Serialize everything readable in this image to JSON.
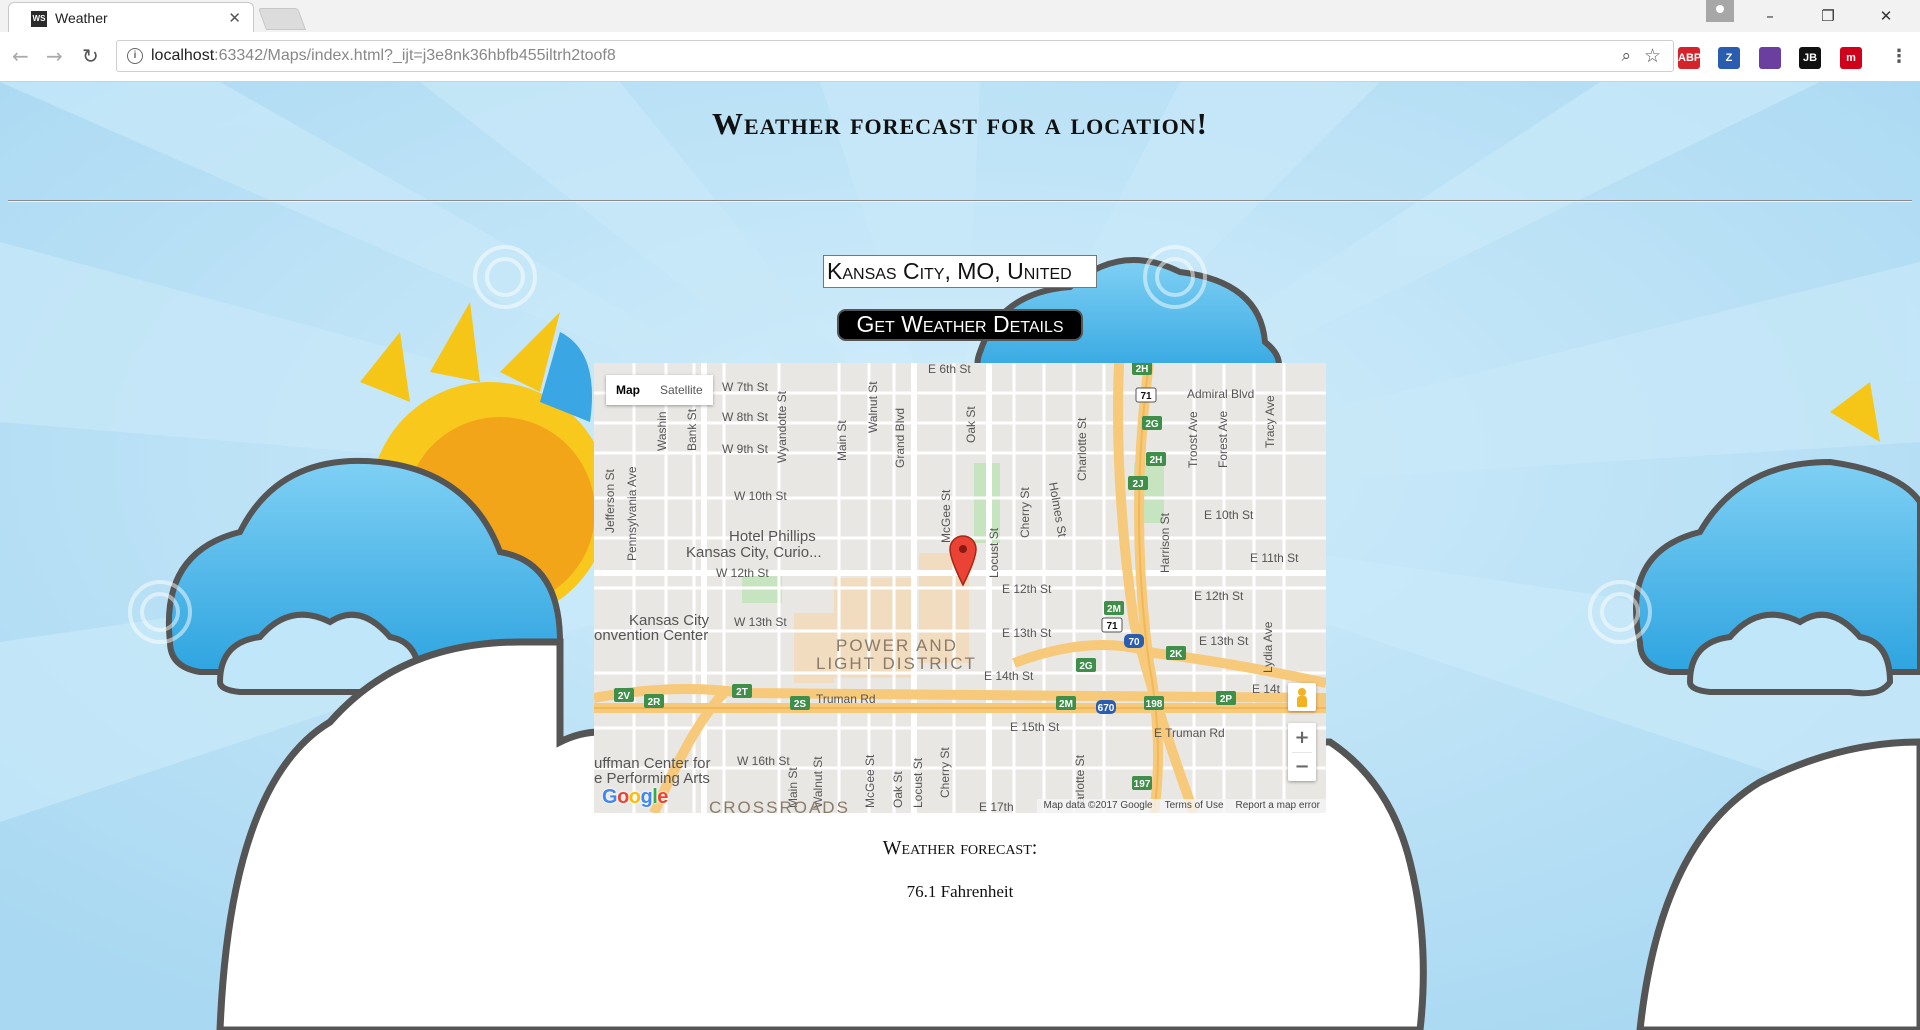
{
  "browser": {
    "tab_title": "Weather",
    "tab_icon": "webstorm-icon",
    "tab_icon_text": "WS",
    "url_host": "localhost",
    "url_rest": ":63342/Maps/index.html?_ijt=j3e8nk36hbfb455iltrh2toof8",
    "extensions": [
      {
        "name": "adblock-plus-icon",
        "label": "ABP",
        "color": "#d4232a"
      },
      {
        "name": "zotero-icon",
        "label": "Z",
        "color": "#2a5db0"
      },
      {
        "name": "bookmark-extension-icon",
        "label": "",
        "color": "#6a3fa0"
      },
      {
        "name": "jetbrains-icon",
        "label": "JB",
        "color": "#111111"
      },
      {
        "name": "m-extension-icon",
        "label": "m",
        "color": "#d0021b"
      }
    ]
  },
  "page": {
    "title": "Weather forecast for a location!",
    "city_value": "Kansas City, MO, United",
    "get_button": "Get Weather Details",
    "forecast_label": "Weather forecast:",
    "forecast_value": "76.1 Fahrenheit"
  },
  "map": {
    "type_map": "Map",
    "type_satellite": "Satellite",
    "zoom_in": "+",
    "zoom_out": "−",
    "map_data": "Map data ©2017 Google",
    "terms": "Terms of Use",
    "report": "Report a map error",
    "logo_letters": [
      "G",
      "o",
      "o",
      "g",
      "l",
      "e"
    ],
    "logo_colors": [
      "#4285f4",
      "#ea4335",
      "#fbbc05",
      "#4285f4",
      "#34a853",
      "#ea4335"
    ],
    "labels": {
      "e6th": "E 6th St",
      "w7th": "W 7th St",
      "w8th": "W 8th St",
      "w9th": "W 9th St",
      "w10th": "W 10th St",
      "w12th": "W 12th St",
      "w13th": "W 13th St",
      "w16th": "W 16th St",
      "e10th": "E 10th St",
      "e11th": "E 11th St",
      "e12th": "E 12th St",
      "e12th_b": "E 12th St",
      "e13th": "E 13th St",
      "e13th_b": "E 13th St",
      "e14th": "E 14th St",
      "e14t": "E 14t",
      "e15th": "E 15th St",
      "e17th": "E 17th",
      "truman": "Truman Rd",
      "e_truman": "E Truman Rd",
      "admiral": "Admiral Blvd",
      "jefferson": "Jefferson St",
      "pennsylvania": "Pennsylvania Ave",
      "washin": "Washin",
      "bank": "Bank St",
      "wyandotte": "Wyandotte St",
      "main": "Main St",
      "walnut": "Walnut St",
      "grand": "Grand Blvd",
      "oak": "Oak St",
      "mcgee": "McGee St",
      "locust": "Locust St",
      "cherry": "Cherry St",
      "holmes": "Holmes St",
      "charlotte": "Charlotte St",
      "harrison": "Harrison St",
      "troost": "Troost Ave",
      "forest": "Forest Ave",
      "tracy": "Tracy Ave",
      "lydia": "Lydia Ave",
      "main_b": "Main St",
      "walnut_b": "Walnut St",
      "mcgee_b": "McGee St",
      "oak_b": "Oak St",
      "locust_b": "Locust St",
      "cherry_b": "Cherry St",
      "charlotte_b": "arlotte St",
      "hotel1": "Hotel Phillips",
      "hotel2": "Kansas City, Curio...",
      "conv1": "Kansas City",
      "conv2": "onvention Center",
      "power1": "POWER AND",
      "power2": "LIGHT DISTRICT",
      "kauffman1": "uffman Center for",
      "kauffman2": "e Performing Arts",
      "crossroads": "CROSSROADS"
    },
    "shields": [
      "71",
      "2G",
      "2H",
      "2J",
      "2M",
      "71",
      "70",
      "2G",
      "2K",
      "2P",
      "2V",
      "2R",
      "2T",
      "2S",
      "2M",
      "670",
      "198",
      "197",
      "2H"
    ]
  }
}
